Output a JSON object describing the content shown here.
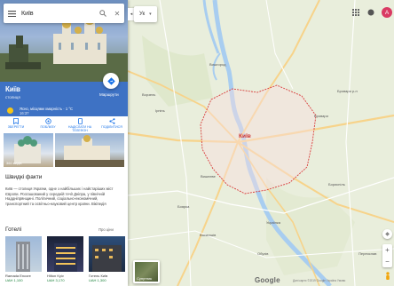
{
  "search": {
    "value": "Київ"
  },
  "place": {
    "title": "Київ",
    "subtitle": "столиця",
    "route_label": "Маршрути",
    "weather_text": "Ясно, місцями хмарність · 1 °C",
    "weather_time": "16:37"
  },
  "actions": [
    {
      "label": "Зберегти",
      "icon": "bookmark-icon"
    },
    {
      "label": "Поблизу",
      "icon": "nearby-icon"
    },
    {
      "label": "Надіслати на телефон",
      "icon": "phone-icon"
    },
    {
      "label": "Поділитися",
      "icon": "share-icon"
    }
  ],
  "photos": [
    {
      "label": "360 видів"
    },
    {
      "label": ""
    }
  ],
  "facts": {
    "title": "Швидкі факти",
    "text": "Київ — столиця України, одне з найбільших і найстаріших міст Європи. Розташований у середній течії Дніпра, у північній Наддніпрянщині. Політичний, соціально-економічний, транспортний та освітньо-науковий центр країни. Вікіпедія"
  },
  "hotels": {
    "title": "Готелі",
    "more_label": "Про ціни",
    "items": [
      {
        "name": "Ramada Encore",
        "price": "UAH 1,100"
      },
      {
        "name": "Hilton Kyiv",
        "price": "UAH 3,170"
      },
      {
        "name": "Готель Київ",
        "price": "UAH 1,300"
      }
    ]
  },
  "map": {
    "layer_select": "Ук",
    "kyiv_label": "Київ",
    "city_labels": [
      "Вишгород",
      "Бровари",
      "Ірпінь",
      "Бориспіль",
      "Вишневе",
      "Боярка",
      "Обухів",
      "Переяслав",
      "Українка",
      "Васильків",
      "Бровари р-н",
      "Ворзель"
    ],
    "satellite_label": "Супутник",
    "google_logo": "Google",
    "footer": "Дані карти ©2019 Google  Україна  Умови"
  },
  "user": {
    "avatar_letter": "A"
  },
  "colors": {
    "panel_blue": "#3e72c4",
    "boundary_red": "#d93b3b",
    "accent": "#1a73e8"
  }
}
